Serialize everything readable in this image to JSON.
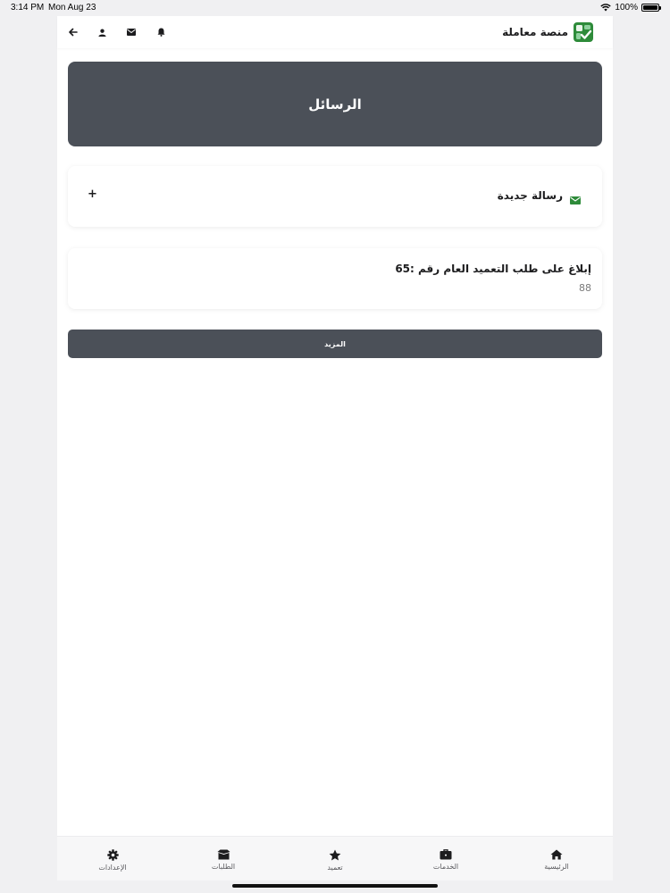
{
  "status_bar": {
    "time": "3:14 PM",
    "date": "Mon Aug 23",
    "battery": "100%"
  },
  "header": {
    "brand_title": "منصة معاملة",
    "icons": [
      "back-arrow-icon",
      "user-icon",
      "envelope-icon",
      "bell-icon"
    ]
  },
  "banner": {
    "title": "الرسائل"
  },
  "new_message": {
    "label": "رسالة جديدة",
    "plus": "+"
  },
  "messages": [
    {
      "subject": "إبلاغ على طلب التعميد العام رقم :65",
      "sub": "88"
    }
  ],
  "more_button": {
    "label": "المزيد"
  },
  "tab_bar": {
    "items": [
      {
        "label": "الرئيسية",
        "icon": "home-icon"
      },
      {
        "label": "الخدمات",
        "icon": "briefcase-icon"
      },
      {
        "label": "تعميد",
        "icon": "star-icon"
      },
      {
        "label": "الطلبات",
        "icon": "box-icon"
      },
      {
        "label": "الإعدادات",
        "icon": "gear-icon"
      }
    ]
  },
  "colors": {
    "dark_slate": "#4b5058",
    "accent_green": "#2e8b3a",
    "page_background": "#f0f0f2"
  }
}
